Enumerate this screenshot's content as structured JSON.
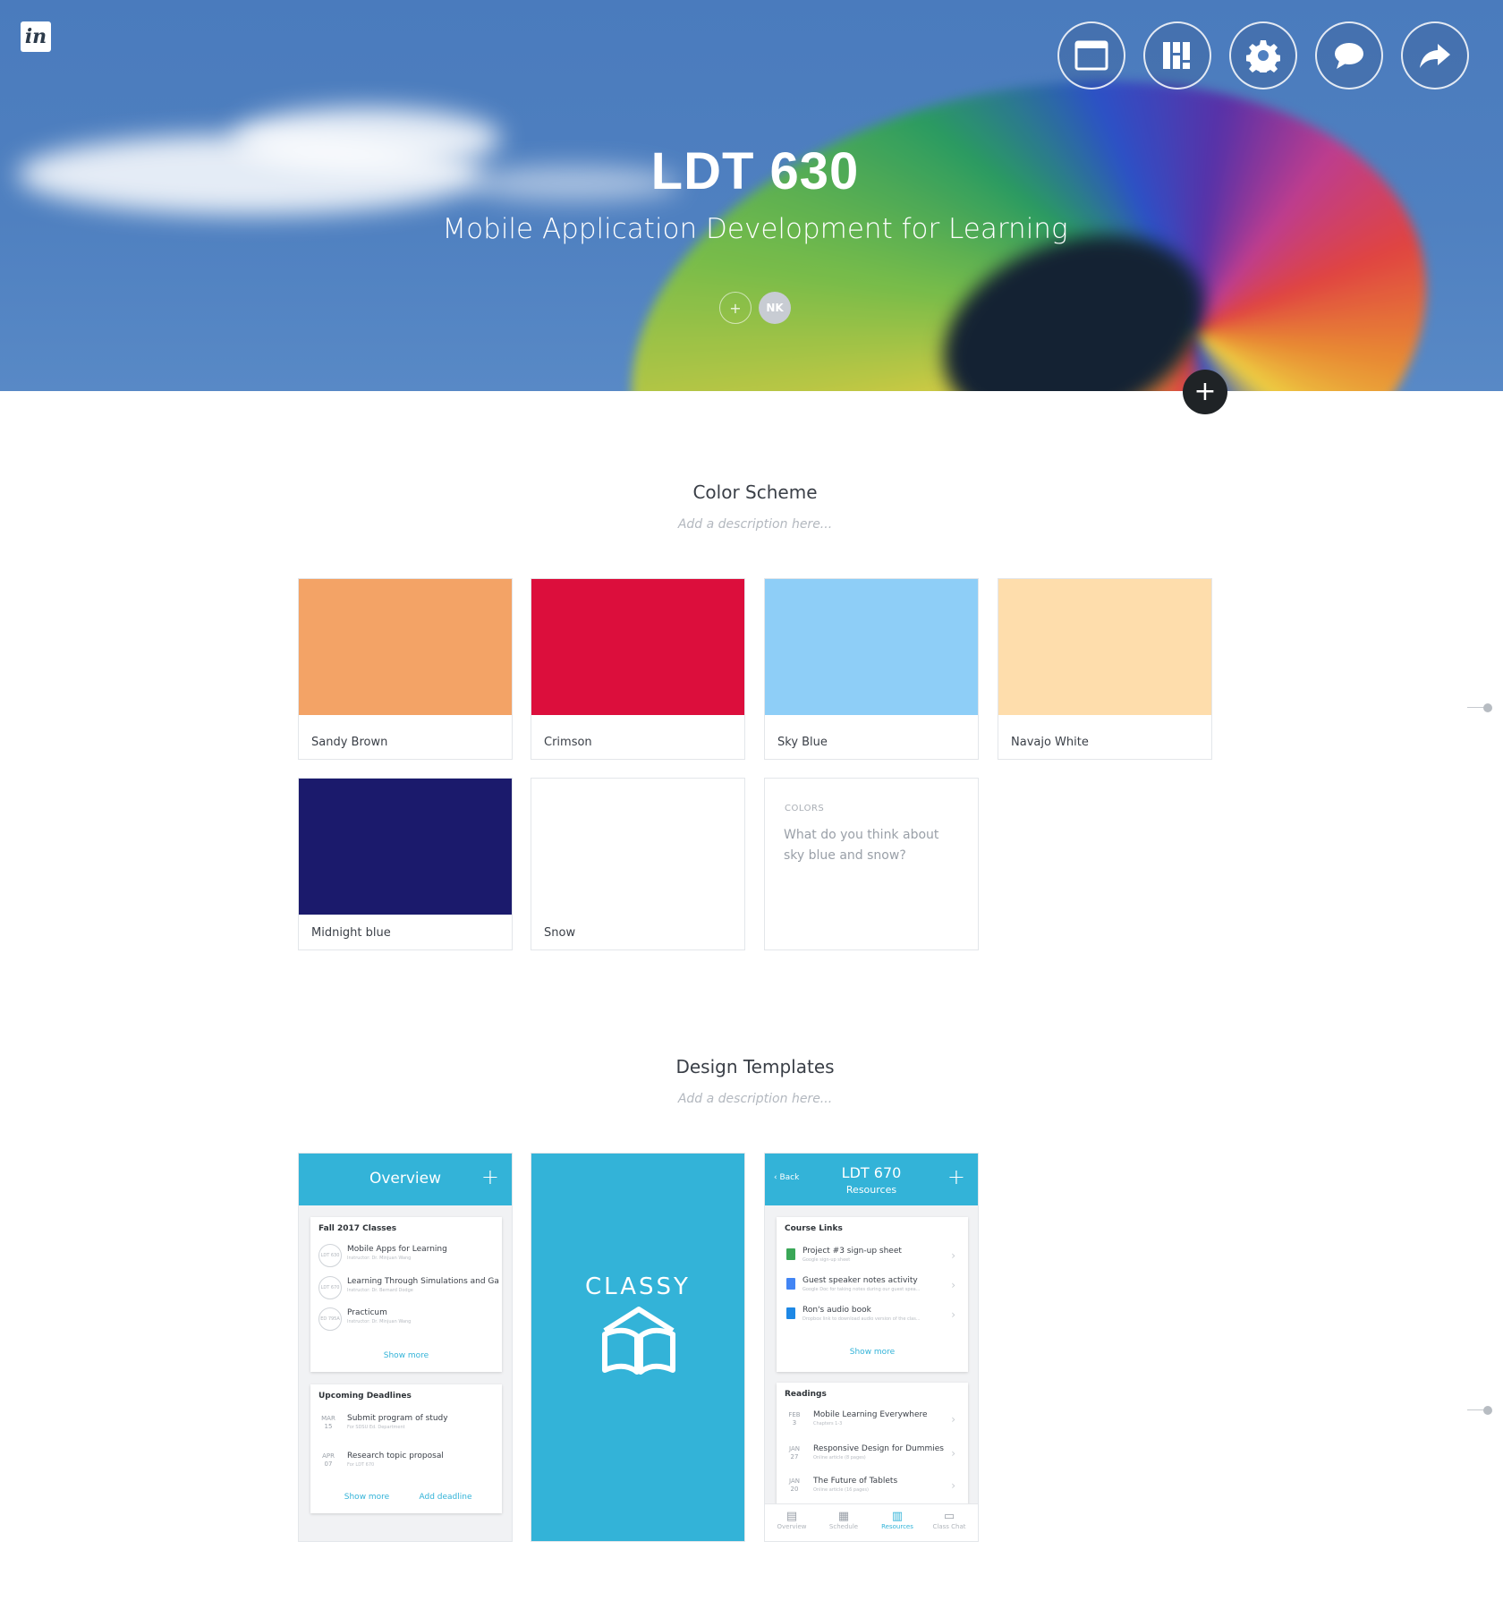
{
  "header": {
    "logo": "in",
    "title": "LDT 630",
    "subtitle": "Mobile Application Development for Learning",
    "avatar_initials": "NK",
    "add_person": "+",
    "add_section": "+",
    "actions": [
      {
        "name": "layout-icon"
      },
      {
        "name": "dashboard-icon"
      },
      {
        "name": "gear-icon"
      },
      {
        "name": "comment-icon"
      },
      {
        "name": "share-icon"
      }
    ]
  },
  "color_section": {
    "title": "Color Scheme",
    "description_placeholder": "Add a description here...",
    "swatches": [
      {
        "name": "Sandy Brown",
        "color": "#F3A366"
      },
      {
        "name": "Crimson",
        "color": "#DC0E3C"
      },
      {
        "name": "Sky Blue",
        "color": "#8ECEF7"
      },
      {
        "name": "Navajo White",
        "color": "#FEDDAC"
      },
      {
        "name": "Midnight blue",
        "color": "#1B1A6C"
      },
      {
        "name": "Snow",
        "color": "#FFFFFF"
      }
    ],
    "note": {
      "tag": "COLORS",
      "text": "What do you think about sky blue and snow?"
    }
  },
  "templates_section": {
    "title": "Design Templates",
    "description_placeholder": "Add a description here...",
    "overview": {
      "bar_title": "Overview",
      "plus": "+",
      "classes_header": "Fall 2017 Classes",
      "classes": [
        {
          "code": "LDT 630",
          "title": "Mobile Apps for Learning",
          "sub": "Instructor: Dr. Minjuan Wang"
        },
        {
          "code": "LDT 670",
          "title": "Learning Through Simulations and Ga...",
          "sub": "Instructor: Dr. Bernard Dodge"
        },
        {
          "code": "ED 795A",
          "title": "Practicum",
          "sub": "Instructor: Dr. Minjuan Wang"
        }
      ],
      "classes_show_more": "Show more",
      "deadlines_header": "Upcoming Deadlines",
      "deadlines": [
        {
          "month": "MAR",
          "day": "15",
          "title": "Submit program of study",
          "sub": "For SDSU Ed. Department"
        },
        {
          "month": "APR",
          "day": "07",
          "title": "Research topic proposal",
          "sub": "For LDT 670"
        }
      ],
      "deadlines_show_more": "Show more",
      "add_deadline": "Add deadline"
    },
    "splash": {
      "word": "CLASSY"
    },
    "resources": {
      "back": "Back",
      "title": "LDT 670",
      "subtitle": "Resources",
      "plus": "+",
      "links_header": "Course Links",
      "links": [
        {
          "title": "Project #3 sign-up sheet",
          "sub": "Google sign-up sheet",
          "color": "#3aa757"
        },
        {
          "title": "Guest speaker notes activity",
          "sub": "Google Doc for taking notes during our guest spea...",
          "color": "#4285f4"
        },
        {
          "title": "Ron's audio book",
          "sub": "Dropbox link to download audio version of the clas...",
          "color": "#1e88e5"
        }
      ],
      "links_show_more": "Show more",
      "readings_header": "Readings",
      "readings": [
        {
          "month": "FEB",
          "day": "3",
          "title": "Mobile Learning Everywhere",
          "sub": "Chapters 1-3"
        },
        {
          "month": "JAN",
          "day": "27",
          "title": "Responsive Design for Dummies",
          "sub": "Online article (8 pages)"
        },
        {
          "month": "JAN",
          "day": "20",
          "title": "The Future of Tablets",
          "sub": "Online article (16 pages)"
        }
      ],
      "tabs": [
        {
          "label": "Overview",
          "icon": "books-icon"
        },
        {
          "label": "Schedule",
          "icon": "calendar-icon"
        },
        {
          "label": "Resources",
          "icon": "book-open-icon",
          "active": true
        },
        {
          "label": "Class Chat",
          "icon": "chat-icon"
        }
      ]
    }
  }
}
